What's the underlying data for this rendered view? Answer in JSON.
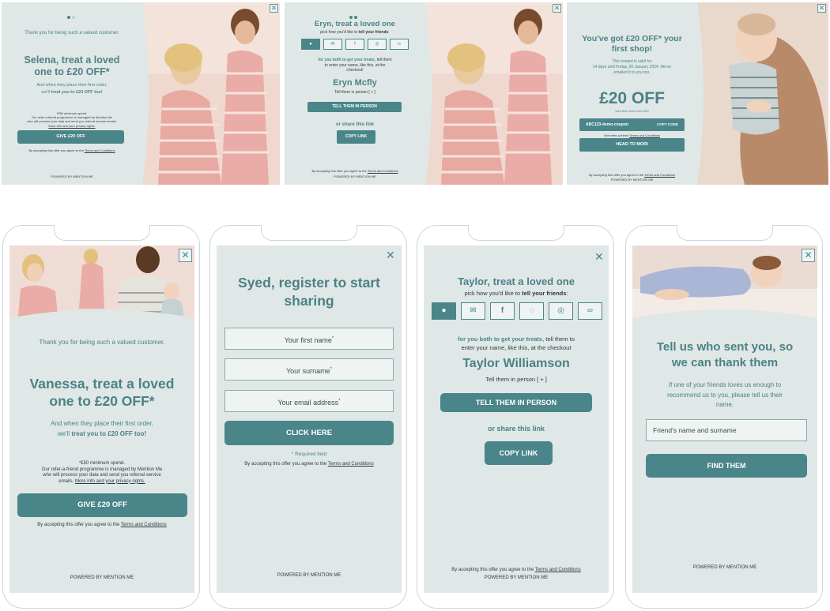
{
  "colors": {
    "panel_bg": "#dfe8e7",
    "accent": "#4a8589",
    "text_teal": "#4c8185"
  },
  "banner1": {
    "thanks": "Thank you for being such a valued customer.",
    "heading_line1": "Selena, treat a loved",
    "heading_line2": "one to £20 OFF*",
    "sub_line1": "And when they place their first order,",
    "sub_pre": "we'll ",
    "sub_bold": "treat you to £20 OFF too!",
    "fine_line1": "*£50 minimum spend.",
    "fine_line2": "Our refer-a-friend programme is managed by Mention Me",
    "fine_line3": "who will process your data and send you referral service emails.",
    "fine_link": "More info and your privacy rights.",
    "button": "GIVE £20 OFF",
    "terms_pre": "By accepting this offer you agree to the ",
    "terms_link": "Terms and Conditions",
    "powered": "POWERED BY MENTION ME",
    "close": "✕"
  },
  "banner2": {
    "heading": "Eryn, treat a loved one",
    "pick_pre": "pick how you'd like to ",
    "pick_bold": "tell your friends",
    "pick_post": ":",
    "icons": [
      "chat-icon",
      "mail-icon",
      "facebook-icon",
      "messenger-icon",
      "link-icon"
    ],
    "icon_glyphs": [
      "●",
      "✉",
      "f",
      "◎",
      "∞"
    ],
    "info_bold": "for you both to get your treats",
    "info_rest1": ", tell them",
    "info_line2": "to enter your name, like this, at the",
    "info_line3": "checkout!",
    "name": "Eryn Mcfly",
    "tell_person": "Tell them in person [ + ]",
    "button_person": "TELL THEM IN PERSON",
    "or_share": "or share this link",
    "button_copy": "COPY LINK",
    "terms_pre": "By accepting this offer you agree to the ",
    "terms_link": "Terms and Conditions",
    "powered": "POWERED BY MENTION ME",
    "close": "✕"
  },
  "banner3": {
    "heading_line1": "You've got £20 OFF* your",
    "heading_line2": "first shop!",
    "reward_line1": "This reward is valid for",
    "reward_line2": "14 days until Friday, 26 January 2024. We've",
    "reward_line3": "emailed it to you too.",
    "amount": "£20 OFF",
    "first_order": "your first order over £50",
    "coupon": "ABC123-demo-coupon",
    "copy_code": "COPY CODE",
    "see_pre": "See refer-a-friend ",
    "see_link": "Terms and Conditions",
    "button": "HEAD TO MORI",
    "terms_pre": "By accepting this offer you agree to the ",
    "terms_link": "Terms and Conditions",
    "powered": "POWERED BY MENTION ME",
    "close": "✕"
  },
  "phone1": {
    "thanks": "Thank you for being such a valued customer.",
    "heading_line1": "Vanessa, treat a loved",
    "heading_line2": "one to £20 OFF*",
    "sub_line1": "And when they place their first order,",
    "sub_pre": "we'll ",
    "sub_bold": "treat you to £20 OFF too!",
    "fine_line1": "*£50 minimum spend.",
    "fine_line2": "Our refer-a-friend programme is managed by Mention Me",
    "fine_line3": "who will process your data and send you referral service",
    "fine_line4_pre": "emails. ",
    "fine_link": "More info and your privacy rights.",
    "button": "GIVE £20 OFF",
    "terms_pre": "By accepting this offer you agree to the ",
    "terms_link": "Terms and Conditions",
    "powered": "POWERED BY MENTION ME",
    "close": "✕"
  },
  "phone2": {
    "heading_line1": "Syed, register to start",
    "heading_line2": "sharing",
    "first_name": "Your first name",
    "surname": "Your surname",
    "email": "Your email address",
    "required_mark": "*",
    "button": "CLICK HERE",
    "required_note": "* Required field",
    "terms_pre": "By accepting this offer you agree to the ",
    "terms_link": "Terms and Conditions",
    "powered": "POWERED BY MENTION ME",
    "close": "✕"
  },
  "phone3": {
    "heading": "Taylor, treat a loved one",
    "pick_pre": "pick how you'd like to ",
    "pick_bold": "tell your friends",
    "pick_post": ":",
    "icons": [
      "chat-icon",
      "mail-icon",
      "facebook-icon",
      "whatsapp-icon",
      "messenger-icon",
      "link-icon"
    ],
    "icon_glyphs": [
      "●",
      "✉",
      "f",
      "◌",
      "◎",
      "∞"
    ],
    "info_bold": "for you both to get your treats",
    "info_rest1": ", tell them to",
    "info_line2": "enter your name, like this, at the checkout",
    "name": "Taylor Williamson",
    "tell_person": "Tell them in person [ + ]",
    "button_person": "TELL THEM IN PERSON",
    "or_share": "or share this link",
    "button_copy": "COPY LINK",
    "terms_pre": "By accepting this offer you agree to the ",
    "terms_link": "Terms and Conditions",
    "powered": "POWERED BY MENTION ME",
    "close": "✕"
  },
  "phone4": {
    "heading_line1": "Tell us who sent you, so",
    "heading_line2": "we can thank them",
    "body_line1": "If one of your friends loves us enough to",
    "body_line2": "recommend us to you, please tell us their",
    "body_line3": "name.",
    "placeholder": "Friend's name and surname",
    "button": "FIND THEM",
    "powered": "POWERED BY MENTION ME",
    "close": "✕"
  }
}
